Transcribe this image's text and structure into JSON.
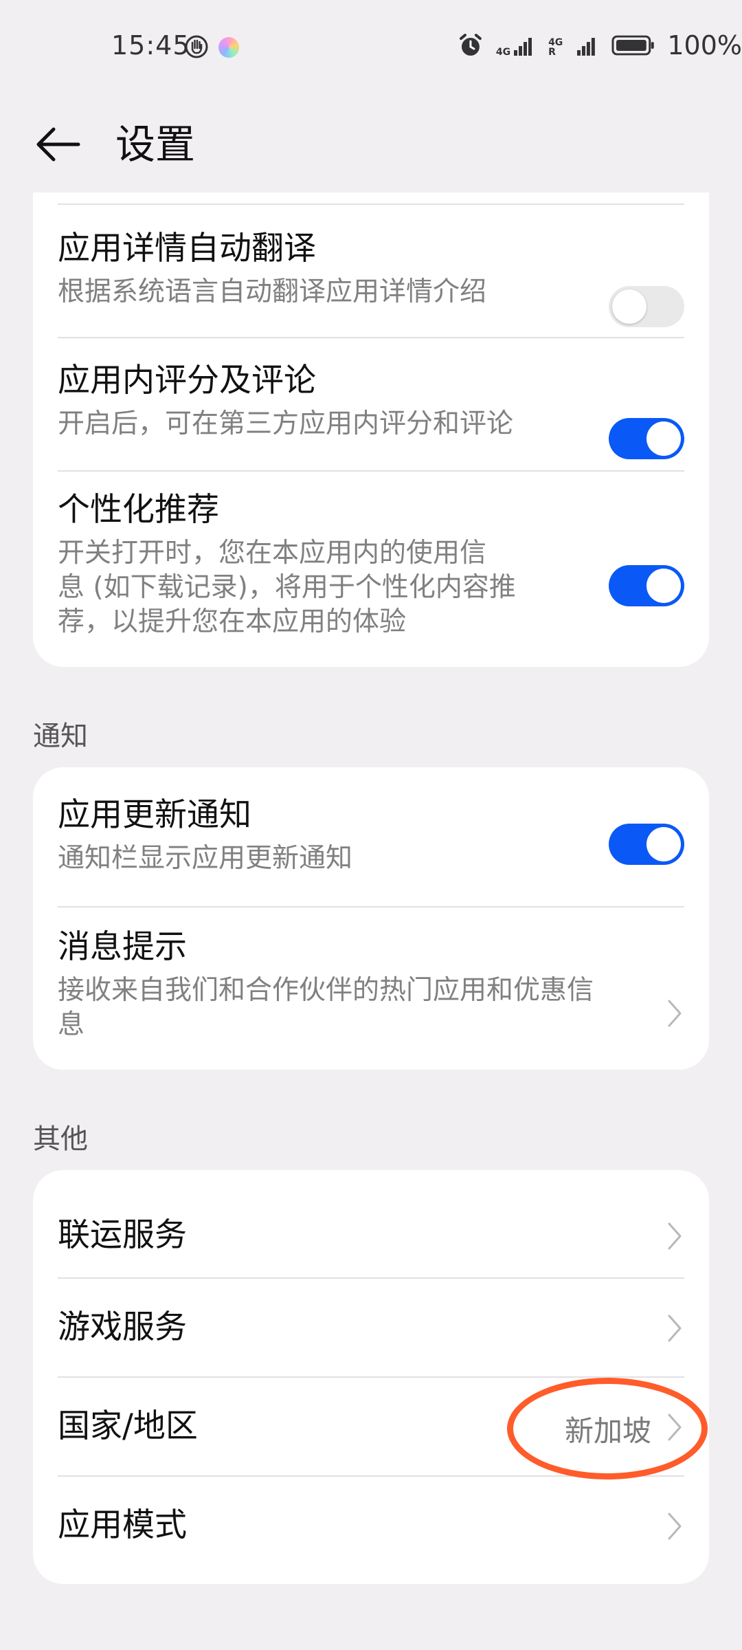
{
  "status_bar": {
    "time": "15:45",
    "network_1": "4G",
    "network_2": "4G R",
    "battery": "100%",
    "icons": [
      "hand-icon",
      "color-dot-icon",
      "alarm-icon",
      "signal-icon",
      "signal-icon",
      "battery-icon"
    ]
  },
  "header": {
    "title": "设置",
    "back_icon": "back-arrow-icon"
  },
  "card1": {
    "items": [
      {
        "title": "应用详情自动翻译",
        "subtitle": "根据系统语言自动翻译应用详情介绍",
        "toggle": "off"
      },
      {
        "title": "应用内评分及评论",
        "subtitle": "开启后，可在第三方应用内评分和评论",
        "toggle": "on"
      },
      {
        "title": "个性化推荐",
        "subtitle_lines": [
          "开关打开时，您在本应用内的使用信",
          "息 (如下载记录)，将用于个性化内容推",
          "荐，以提升您在本应用的体验"
        ],
        "toggle": "on"
      }
    ]
  },
  "notifications": {
    "section_label": "通知",
    "items": [
      {
        "title": "应用更新通知",
        "subtitle": "通知栏显示应用更新通知",
        "toggle": "on"
      },
      {
        "title": "消息提示",
        "subtitle_lines": [
          "接收来自我们和合作伙伴的热门应用和优惠信",
          "息"
        ]
      }
    ]
  },
  "other": {
    "section_label": "其他",
    "items": [
      {
        "title": "联运服务"
      },
      {
        "title": "游戏服务"
      },
      {
        "title": "国家/地区",
        "value": "新加坡"
      },
      {
        "title": "应用模式"
      }
    ]
  },
  "colors": {
    "accent": "#0a59f7",
    "background": "#f2eff3",
    "annotation": "#ff5c2a"
  }
}
